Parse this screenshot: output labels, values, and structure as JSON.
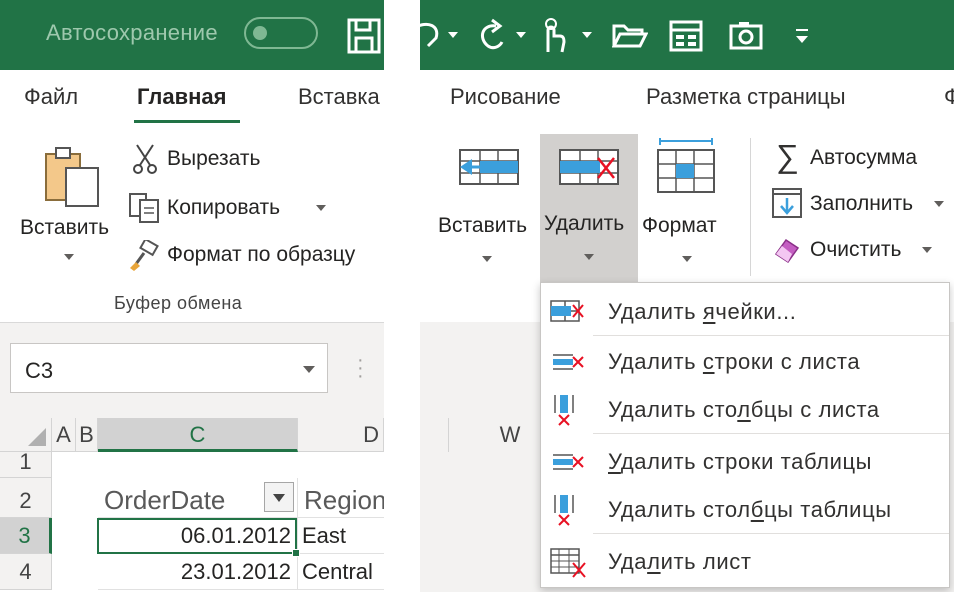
{
  "title_bar": {
    "autosave_label": "Автосохранение",
    "icons": [
      "save-icon",
      "undo-icon",
      "redo-icon",
      "touch-mode-icon",
      "open-folder-icon",
      "form-icon",
      "camera-icon",
      "customize-toolbar-icon"
    ]
  },
  "tabs": [
    {
      "label": "Файл"
    },
    {
      "label": "Главная",
      "active": true
    },
    {
      "label": "Вставка"
    },
    {
      "label": "Рисование"
    },
    {
      "label": "Разметка страницы"
    },
    {
      "label": "Ф"
    }
  ],
  "clipboard": {
    "paste_label": "Вставить",
    "cut_label": "Вырезать",
    "copy_label": "Копировать",
    "format_painter_label": "Формат по образцу",
    "group_label": "Буфер обмена"
  },
  "cells_group": {
    "insert_label": "Вставить",
    "delete_label": "Удалить",
    "format_label": "Формат"
  },
  "editing_group": {
    "autosum_label": "Автосумма",
    "fill_label": "Заполнить",
    "clear_label": "Очистить"
  },
  "namebox": {
    "value": "C3"
  },
  "grid": {
    "columns": [
      "A",
      "B",
      "C",
      "D"
    ],
    "right_column": "W",
    "rows": [
      "1",
      "2",
      "3",
      "4"
    ],
    "header_orderdate": "OrderDate",
    "header_region": "Region",
    "row3": {
      "date": "06.01.2012",
      "region": "East"
    },
    "row4": {
      "date": "23.01.2012",
      "region": "Central"
    }
  },
  "delete_menu": {
    "items": [
      {
        "pre": "Удалить ",
        "key": "я",
        "post": "чейки..."
      },
      {
        "pre": "Удалить ",
        "key": "с",
        "post": "троки с листа"
      },
      {
        "pre": "Удалить сто",
        "key": "л",
        "post": "бцы с листа"
      },
      {
        "pre": "",
        "key": "У",
        "post": "далить строки таблицы"
      },
      {
        "pre": "Удалить стол",
        "key": "б",
        "post": "цы таблицы"
      },
      {
        "pre": "Уда",
        "key": "л",
        "post": "ить лист"
      }
    ]
  },
  "colors": {
    "accent_green": "#217346",
    "delete_red": "#e81123",
    "cell_blue": "#3b9fdc"
  }
}
